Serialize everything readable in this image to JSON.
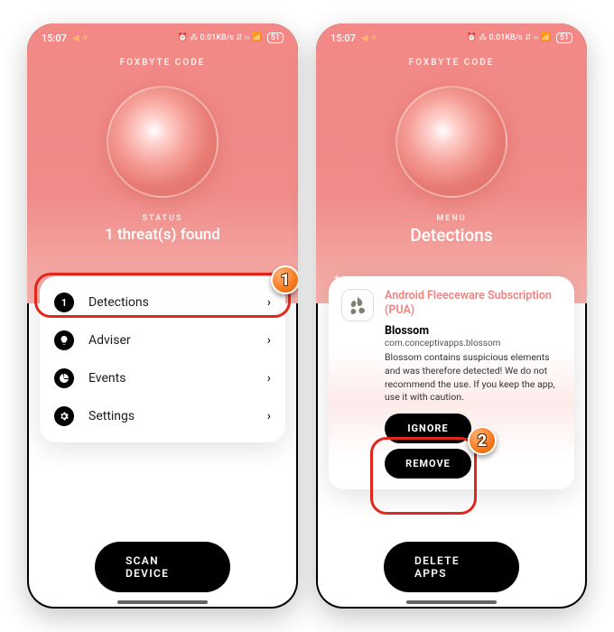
{
  "shared": {
    "status_bar": {
      "time": "15:07",
      "icons_left": "◀ ✈",
      "icons_right": "⏰ ⁂ 0.01KB/s ⇵ ›› 📶",
      "battery": "51"
    },
    "brand": "FOXBYTE CODE",
    "home_indicator": true
  },
  "screen1": {
    "status_label": "STATUS",
    "status_text": "1 threat(s) found",
    "menu": [
      {
        "badge": "1",
        "icon": "count",
        "label": "Detections"
      },
      {
        "badge": null,
        "icon": "bulb",
        "label": "Adviser"
      },
      {
        "badge": null,
        "icon": "pie",
        "label": "Events"
      },
      {
        "badge": null,
        "icon": "gear",
        "label": "Settings"
      }
    ],
    "cta": "SCAN DEVICE",
    "step_badge": "1"
  },
  "screen2": {
    "menu_label": "MENU",
    "menu_title": "Detections",
    "threat": {
      "title": "Android Fleeceware Subscription (PUA)",
      "app_name": "Blossom",
      "app_id": "com.conceptivapps.blossom",
      "description": "Blossom contains suspicious elements and was therefore detected! We do not recommend the use. If you keep the app, use it with caution."
    },
    "actions": {
      "ignore": "IGNORE",
      "remove": "REMOVE"
    },
    "cta": "DELETE APPS",
    "step_badge": "2"
  }
}
